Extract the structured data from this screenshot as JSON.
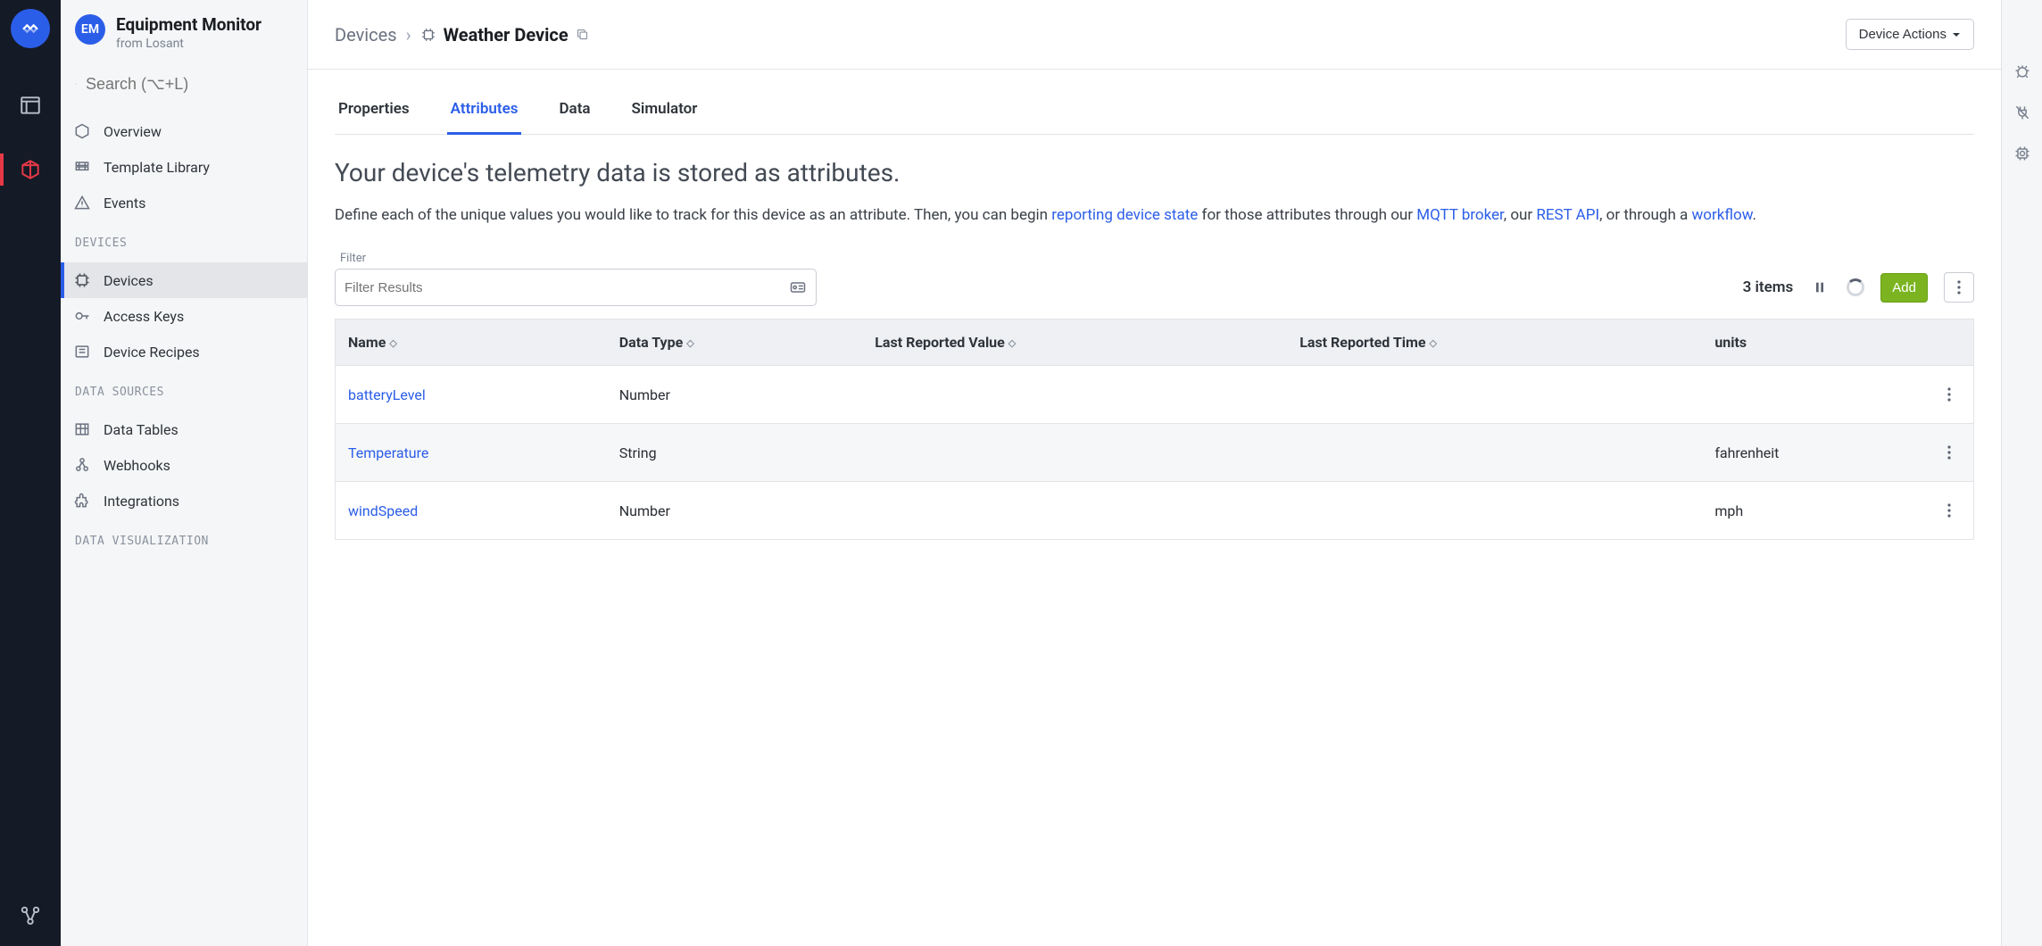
{
  "app": {
    "badge": "EM",
    "title": "Equipment Monitor",
    "subtitle": "from Losant"
  },
  "search": {
    "placeholder": "Search (⌥+L)"
  },
  "nav": {
    "overview": "Overview",
    "template_library": "Template Library",
    "events": "Events",
    "devices_heading": "DEVICES",
    "devices": "Devices",
    "access_keys": "Access Keys",
    "device_recipes": "Device Recipes",
    "data_sources_heading": "DATA SOURCES",
    "data_tables": "Data Tables",
    "webhooks": "Webhooks",
    "integrations": "Integrations",
    "data_viz_heading": "DATA VISUALIZATION"
  },
  "breadcrumb": {
    "parent": "Devices",
    "sep": "›",
    "current": "Weather Device"
  },
  "actions_button": "Device Actions",
  "tabs": {
    "properties": "Properties",
    "attributes": "Attributes",
    "data": "Data",
    "simulator": "Simulator"
  },
  "page_title": "Your device's telemetry data is stored as attributes.",
  "desc": {
    "part1": "Define each of the unique values you would like to track for this device as an attribute. Then, you can begin ",
    "link1": "reporting device state",
    "part2": " for those attributes through our ",
    "link2": "MQTT broker",
    "part3": ", our ",
    "link3": "REST API",
    "part4": ", or through a ",
    "link4": "workflow",
    "part5": "."
  },
  "filter": {
    "label": "Filter",
    "placeholder": "Filter Results"
  },
  "item_count": "3 items",
  "add_button": "Add",
  "table": {
    "headers": {
      "name": "Name",
      "data_type": "Data Type",
      "last_value": "Last Reported Value",
      "last_time": "Last Reported Time",
      "units": "units"
    },
    "rows": [
      {
        "name": "batteryLevel",
        "data_type": "Number",
        "last_value": "",
        "last_time": "",
        "units": ""
      },
      {
        "name": "Temperature",
        "data_type": "String",
        "last_value": "",
        "last_time": "",
        "units": "fahrenheit"
      },
      {
        "name": "windSpeed",
        "data_type": "Number",
        "last_value": "",
        "last_time": "",
        "units": "mph"
      }
    ]
  }
}
